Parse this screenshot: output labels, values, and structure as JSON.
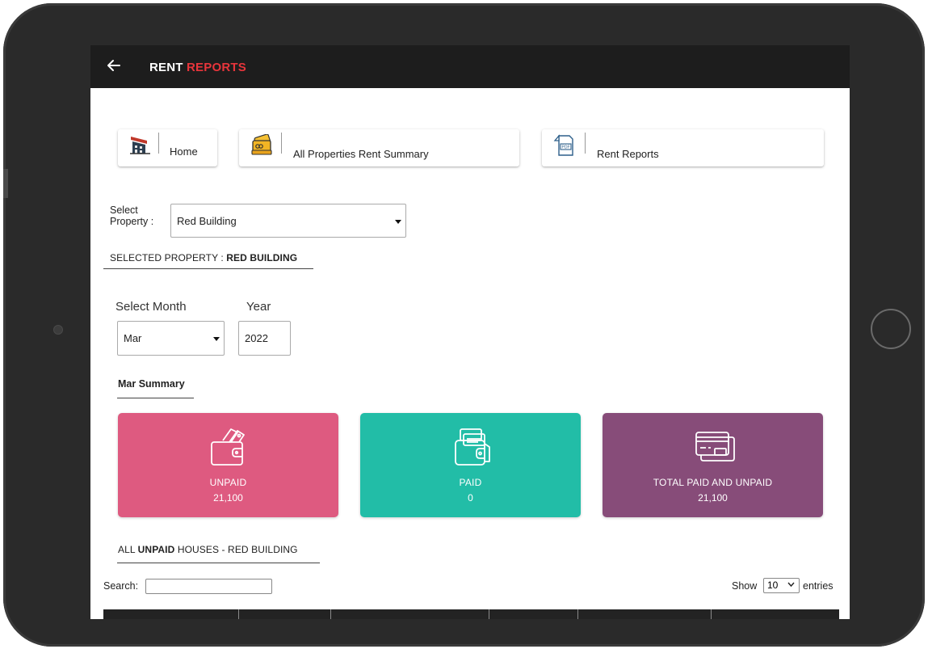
{
  "header": {
    "title_main": "RENT",
    "title_accent": "REPORTS",
    "back_icon": "arrow-left-icon"
  },
  "nav": [
    {
      "label": "Home",
      "icon": "building-icon"
    },
    {
      "label": "All Properties Rent Summary",
      "icon": "money-cards-icon"
    },
    {
      "label": "Rent Reports",
      "icon": "pdf-document-icon"
    }
  ],
  "property": {
    "label_line1": "Select",
    "label_line2": "Property :",
    "selected": "Red Building",
    "selected_prefix": "SELECTED PROPERTY :",
    "selected_name": "RED BUILDING"
  },
  "period": {
    "month_label": "Select Month",
    "year_label": "Year",
    "month": "Mar",
    "year": "2022"
  },
  "summary": {
    "title": "Mar Summary",
    "cards": [
      {
        "title": "UNPAID",
        "value": "21,100",
        "color": "#de5a80",
        "icon": "wallet-icon"
      },
      {
        "title": "PAID",
        "value": "0",
        "color": "#22bda7",
        "icon": "wallet-cash-icon"
      },
      {
        "title": "TOTAL PAID AND UNPAID",
        "value": "21,100",
        "color": "#874c79",
        "icon": "credit-cards-icon"
      }
    ]
  },
  "unpaid_list": {
    "prefix": "ALL",
    "bold": "UNPAID",
    "suffix": "HOUSES - RED BUILDING"
  },
  "table_controls": {
    "search_label": "Search:",
    "search_value": "",
    "show_label": "Show",
    "page_size": "10",
    "entries_label": "entries"
  }
}
